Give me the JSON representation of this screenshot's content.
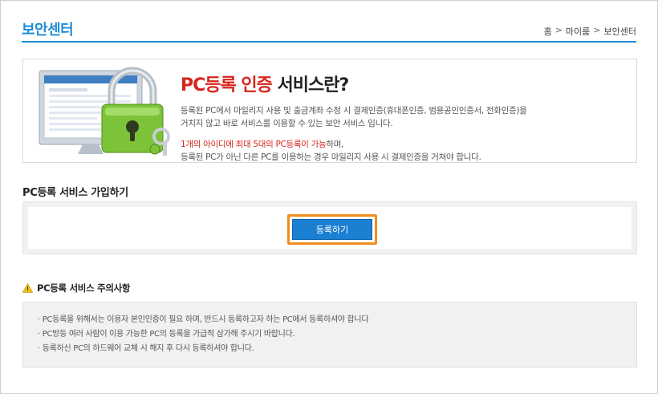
{
  "header": {
    "title": "보안센터",
    "breadcrumb": {
      "home": "홈",
      "my": "마이룸",
      "current": "보안센터",
      "separator": ">"
    }
  },
  "intro": {
    "title_red": "PC등록 인증",
    "title_rest": " 서비스란?",
    "desc_line1": "등록된 PC에서 마일리지 사용 및 출금계좌 수정 시 결제인증(휴대폰인증, 범용공인인증서, 전화인증)을",
    "desc_line2": "거치지 않고 바로 서비스를 이용할 수 있는 보안 서비스 입니다.",
    "note_red": "1개의 아이디에 최대 5대의 PC등록이 가능",
    "note_rest": "하며,",
    "note_line2": "등록된 PC가 아닌 다른 PC를 이용하는 경우 마일리지 사용 시 결제인증을 거쳐야 합니다."
  },
  "register": {
    "section_title": "PC등록 서비스 가입하기",
    "button_label": "등록하기"
  },
  "notice": {
    "title": "PC등록 서비스 주의사항",
    "items": [
      "PC등록을 위해서는 이용자 본인인증이 필요 하며, 반드시 등록하고자 하는 PC에서 등록하셔야 합니다",
      "PC방등 여러 사람이 이용 가능한 PC의 등록을 가급적 삼가해 주시기 바랍니다.",
      "등록하신 PC의 하드웨어 교체 시 해지 후 다시 등록하셔야 합니다."
    ]
  },
  "colors": {
    "accent": "#1f8dd6",
    "highlight": "#f28b1e",
    "red": "#d6261c",
    "button": "#1b7fd2"
  }
}
